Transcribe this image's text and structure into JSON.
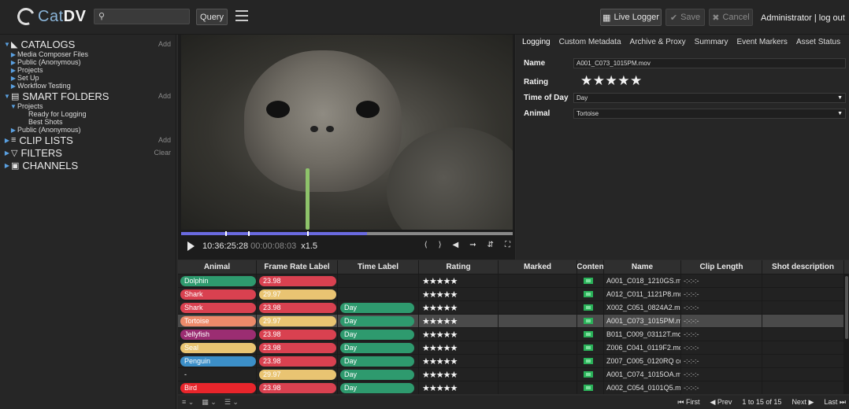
{
  "app": {
    "brand_a": "Cat",
    "brand_b": "DV"
  },
  "header": {
    "query_label": "Query",
    "live_logger_label": "Live Logger",
    "save_label": "Save",
    "cancel_label": "Cancel",
    "user": "Administrator",
    "separator": "|",
    "logout": "log out"
  },
  "sidebar": {
    "catalogs": {
      "label": "CATALOGS",
      "action": "Add",
      "items": [
        "Media Composer Files",
        "Public (Anonymous)",
        "Projects",
        "Set Up",
        "Workflow Testing"
      ]
    },
    "smart_folders": {
      "label": "SMART FOLDERS",
      "action": "Add",
      "projects": "Projects",
      "sub_items": [
        "Ready for Logging",
        "Best Shots"
      ],
      "public": "Public (Anonymous)"
    },
    "clip_lists": {
      "label": "CLIP LISTS",
      "action": "Add"
    },
    "filters": {
      "label": "FILTERS",
      "action": "Clear"
    },
    "channels": {
      "label": "CHANNELS"
    }
  },
  "player": {
    "timecode": "10:36:25:28",
    "duration": "00:00:08:03",
    "speed": "x1.5",
    "progress": 0.56
  },
  "meta": {
    "tabs": [
      "Logging",
      "Custom Metadata",
      "Archive & Proxy",
      "Summary",
      "Event Markers",
      "Asset Status"
    ],
    "name_label": "Name",
    "name_value": "A001_C073_1015PM.mov",
    "rating_label": "Rating",
    "rating_value": "★★★★★",
    "time_label": "Time of Day",
    "time_value": "Day",
    "animal_label": "Animal",
    "animal_value": "Tortoise"
  },
  "table": {
    "columns": [
      "Animal",
      "Frame Rate Label",
      "Time Label",
      "Rating",
      "Marked",
      "Conten",
      "Name",
      "Clip Length",
      "Shot description"
    ],
    "rows": [
      {
        "animal": "Dolphin",
        "animal_color": "#2e9a6e",
        "fr": "23.98",
        "fr_color": "#d94150",
        "time": "",
        "rating": "★★★★★",
        "name": "A001_C018_1210GS.mo",
        "len": "-:-:-:-"
      },
      {
        "animal": "Shark",
        "animal_color": "#d94150",
        "fr": "29.97",
        "fr_color": "#e9c472",
        "time": "",
        "rating": "★★★★★",
        "name": "A012_C011_1121P8.mo",
        "len": "-:-:-:-"
      },
      {
        "animal": "Shark",
        "animal_color": "#d94150",
        "fr": "23.98",
        "fr_color": "#d94150",
        "time": "Day",
        "rating": "★★★★★",
        "name": "X002_C051_0824A2.mo",
        "len": "-:-:-:-"
      },
      {
        "animal": "Tortoise",
        "animal_color": "#ec8a6a",
        "fr": "29.97",
        "fr_color": "#e9c472",
        "time": "Day",
        "rating": "★★★★★",
        "name": "A001_C073_1015PM.mo",
        "len": "-:-:-:-"
      },
      {
        "animal": "Jellyfish",
        "animal_color": "#9b2d72",
        "fr": "23.98",
        "fr_color": "#d94150",
        "time": "Day",
        "rating": "★★★★★",
        "name": "B011_C009_03112T.mo",
        "len": "-:-:-:-"
      },
      {
        "animal": "Seal",
        "animal_color": "#e9c472",
        "fr": "23.98",
        "fr_color": "#d94150",
        "time": "Day",
        "rating": "★★★★★",
        "name": "Z006_C041_0119F2.mo",
        "len": "-:-:-:-"
      },
      {
        "animal": "Penguin",
        "animal_color": "#3c8fc8",
        "fr": "23.98",
        "fr_color": "#d94150",
        "time": "Day",
        "rating": "★★★★★",
        "name": "Z007_C005_0120RQ cop",
        "len": "-:-:-:-"
      },
      {
        "animal": "-",
        "animal_color": "",
        "fr": "29.97",
        "fr_color": "#e9c472",
        "time": "Day",
        "rating": "★★★★★",
        "name": "A001_C074_1015OA.mo",
        "len": "-:-:-:-"
      },
      {
        "animal": "Bird",
        "animal_color": "#e8252b",
        "fr": "23.98",
        "fr_color": "#d94150",
        "time": "Day",
        "rating": "★★★★★",
        "name": "A002_C054_0101Q5.mo",
        "len": "-:-:-:-"
      }
    ],
    "time_color": "#2e9a6e",
    "selected_index": 3
  },
  "footer": {
    "first": "First",
    "prev": "Prev",
    "range": "1 to 15 of 15",
    "next": "Next",
    "last": "Last"
  }
}
